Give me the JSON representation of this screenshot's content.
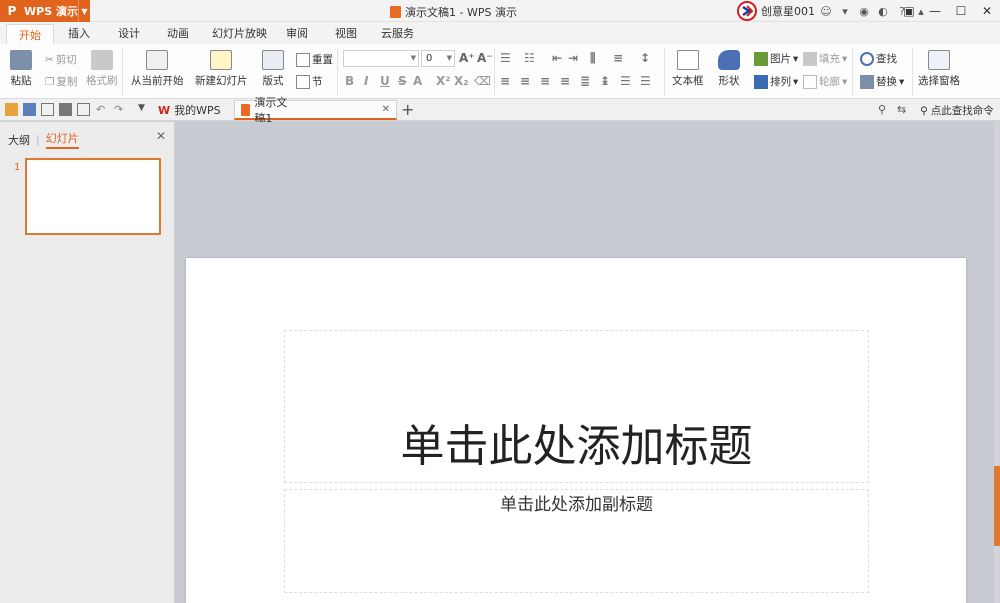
{
  "app": {
    "name": "WPS 演示",
    "logo": "P",
    "window_title": "演示文稿1 - WPS 演示"
  },
  "user": {
    "name": "创意星001"
  },
  "menu": {
    "tabs": [
      "开始",
      "插入",
      "设计",
      "动画",
      "幻灯片放映",
      "审阅",
      "视图",
      "云服务"
    ]
  },
  "ribbon": {
    "paste": "粘贴",
    "cut": "剪切",
    "copy": "复制",
    "format_painter": "格式刷",
    "from_current": "从当前开始",
    "new_slide": "新建幻灯片",
    "layout": "版式",
    "reset": "重置",
    "section": "节",
    "font_size": "0",
    "text_box": "文本框",
    "shape": "形状",
    "picture": "图片",
    "fill": "填充",
    "arrange": "排列",
    "outline": "轮廓",
    "find": "查找",
    "replace": "替换",
    "select_pane": "选择窗格"
  },
  "tabsbar": {
    "my_wps": "我的WPS",
    "doc_tab": "演示文稿1",
    "search_cmd": "点此查找命令"
  },
  "panel": {
    "outline": "大纲",
    "slides": "幻灯片",
    "slide_number": "1"
  },
  "slide": {
    "title_placeholder": "单击此处添加标题",
    "subtitle_placeholder": "单击此处添加副标题"
  },
  "colors": {
    "accent": "#e0641e",
    "canvas": "#c9cbd3"
  }
}
